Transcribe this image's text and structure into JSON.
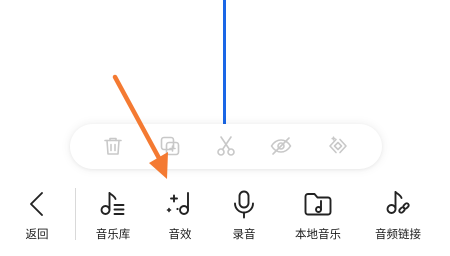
{
  "timeline": {
    "playhead_color": "#1a66e6"
  },
  "edit_toolbar": {
    "tools": [
      {
        "icon": "trash-icon"
      },
      {
        "icon": "copy-icon"
      },
      {
        "icon": "scissors-icon"
      },
      {
        "icon": "eye-off-icon"
      },
      {
        "icon": "audio-effect-icon"
      }
    ]
  },
  "bottom_bar": {
    "back_label": "返回",
    "items": [
      {
        "label": "音乐库",
        "icon": "music-library-icon"
      },
      {
        "label": "音效",
        "icon": "sound-effect-icon"
      },
      {
        "label": "录音",
        "icon": "microphone-icon"
      },
      {
        "label": "本地音乐",
        "icon": "local-music-folder-icon"
      },
      {
        "label": "音频链接",
        "icon": "audio-link-icon"
      }
    ]
  },
  "annotation": {
    "arrow_color": "#f47a32"
  }
}
